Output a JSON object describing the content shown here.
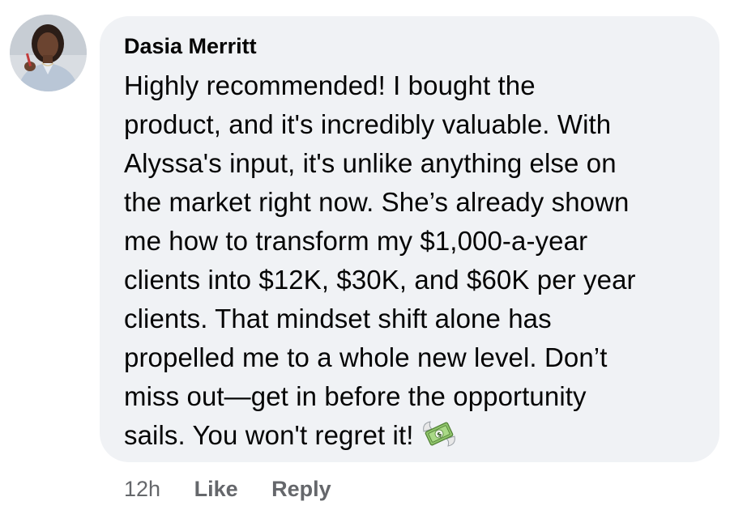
{
  "comment": {
    "author": "Dasia Merritt",
    "avatar_icon": "profile-photo-avatar",
    "text_lines": [
      "Highly recommended! I bought the",
      "product, and it's incredibly valuable. With",
      "Alyssa's input, it's unlike anything else on",
      "the market right now. She’s already shown",
      "me how to transform my $1,000-a-year",
      "clients into $12K, $30K, and $60K per year",
      "clients. That mindset shift alone has",
      "propelled me to a whole new level. Don’t",
      "miss out—get in before the opportunity",
      "sails. You won't regret it!"
    ],
    "emoji_icon": "money-with-wings-icon"
  },
  "actions": {
    "timestamp": "12h",
    "like_label": "Like",
    "reply_label": "Reply"
  },
  "colors": {
    "bubble_background": "#f0f2f5",
    "text": "#050505",
    "secondary_text": "#65676b"
  }
}
